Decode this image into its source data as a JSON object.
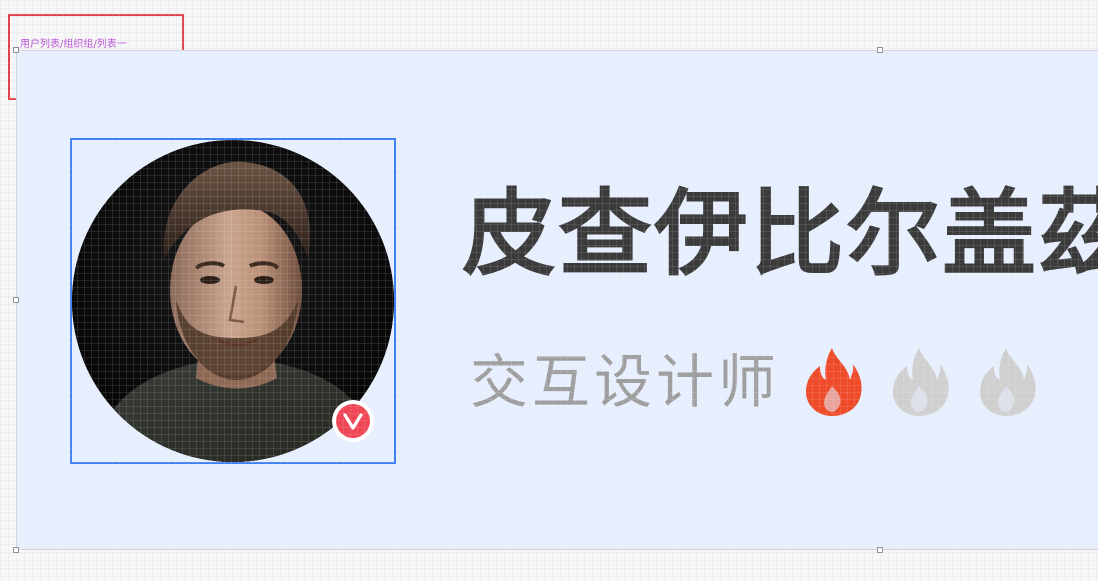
{
  "layer_path": "用户列表/组织组/列表一",
  "card": {
    "name": "皮查伊比尔盖茲",
    "role": "交互设计师",
    "verified_icon": "verified-check-icon",
    "avatar_alt": "avatar-photo",
    "heat_level": 1,
    "heat_max": 3,
    "flame_colors": {
      "active": "#ee4b2b",
      "inactive": "#cfcfcf"
    }
  },
  "colors": {
    "frame_bg": "#e7eefd",
    "selection": "#3d7ef0",
    "annotation": "#e0404a",
    "layer_text": "#b84fd6",
    "badge": "#ee4655"
  }
}
